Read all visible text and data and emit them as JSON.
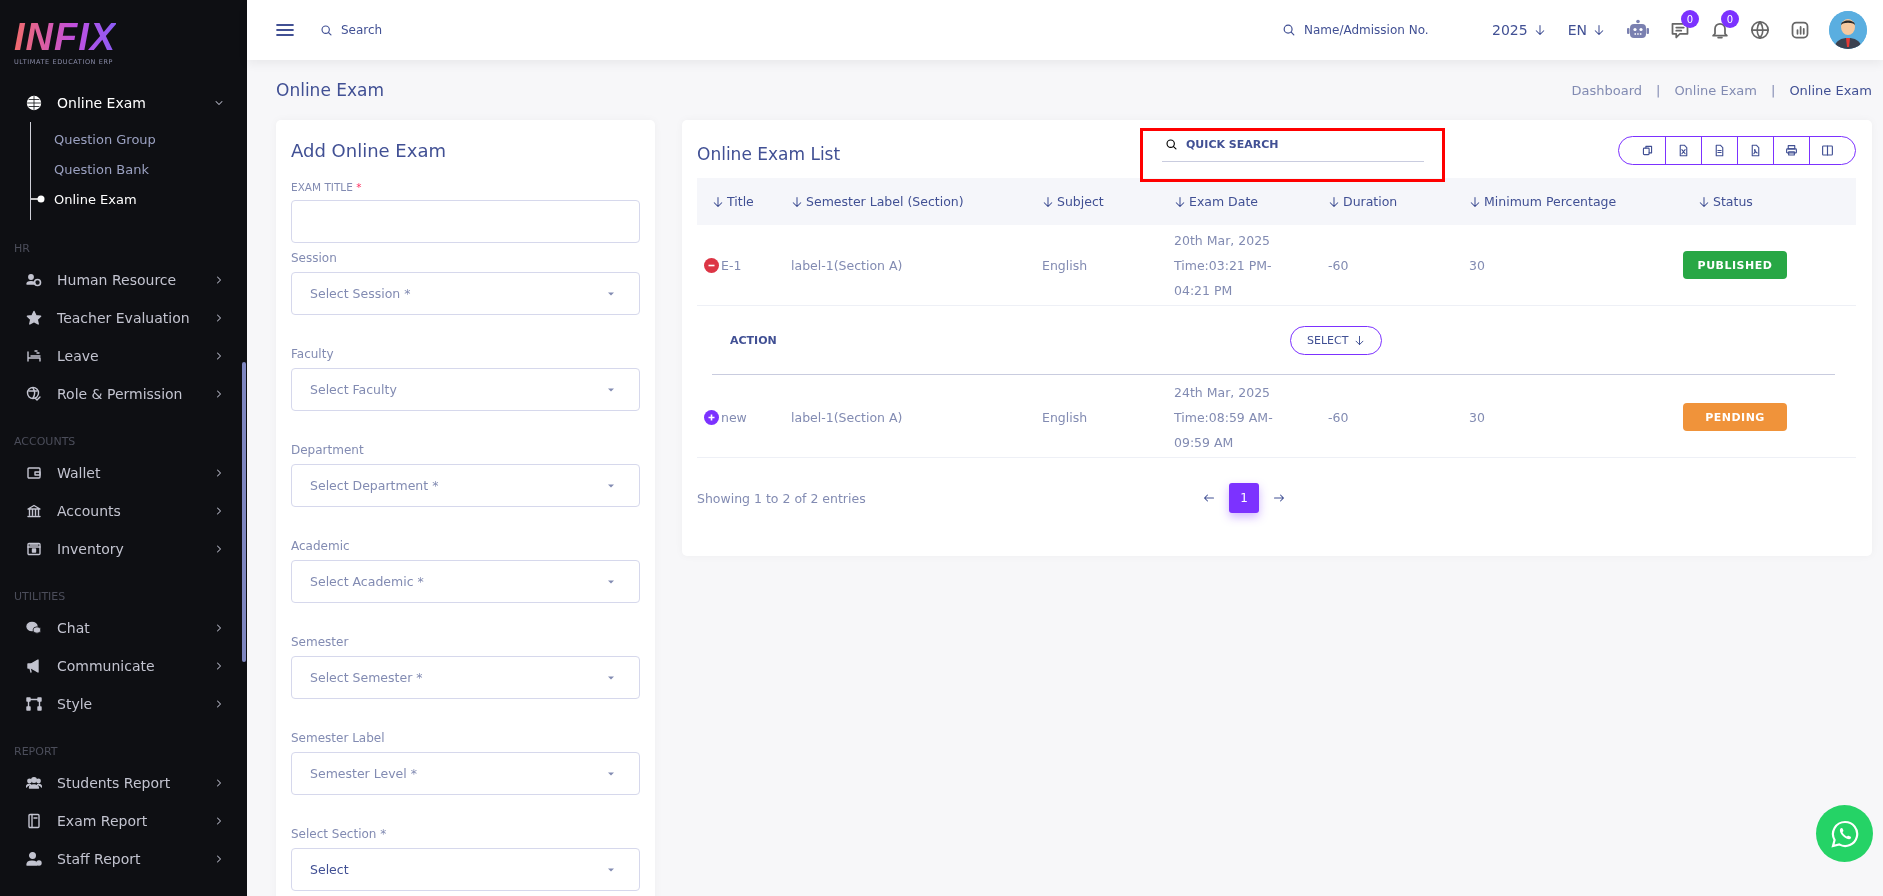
{
  "sidebar": {
    "logo": {
      "name": "INFIX",
      "tagline": "ULTIMATE EDUCATION ERP"
    },
    "sections": [
      {
        "items": [
          {
            "label": "Online Exam",
            "expanded": true,
            "children": [
              {
                "label": "Question Group",
                "selected": false
              },
              {
                "label": "Question Bank",
                "selected": false
              },
              {
                "label": "Online Exam",
                "selected": true
              }
            ]
          }
        ]
      },
      {
        "heading": "HR",
        "items": [
          {
            "label": "Human Resource",
            "expanded": false
          },
          {
            "label": "Teacher Evaluation",
            "expanded": false
          },
          {
            "label": "Leave",
            "expanded": false
          },
          {
            "label": "Role & Permission",
            "expanded": false
          }
        ]
      },
      {
        "heading": "ACCOUNTS",
        "items": [
          {
            "label": "Wallet",
            "expanded": false
          },
          {
            "label": "Accounts",
            "expanded": false
          },
          {
            "label": "Inventory",
            "expanded": false
          }
        ]
      },
      {
        "heading": "UTILITIES",
        "items": [
          {
            "label": "Chat",
            "expanded": false
          },
          {
            "label": "Communicate",
            "expanded": false
          },
          {
            "label": "Style",
            "expanded": false
          }
        ]
      },
      {
        "heading": "REPORT",
        "items": [
          {
            "label": "Students Report",
            "expanded": false
          },
          {
            "label": "Exam Report",
            "expanded": false
          },
          {
            "label": "Staff Report",
            "expanded": false
          }
        ]
      }
    ]
  },
  "topbar": {
    "search": {
      "placeholder": "Search"
    },
    "student_search": {
      "placeholder": "Name/Admission No."
    },
    "year": "2025",
    "language": "EN",
    "messages_badge": "0",
    "notifications_badge": "0"
  },
  "page": {
    "title": "Online Exam",
    "separator": "|",
    "breadcrumb": [
      {
        "label": "Dashboard",
        "selected": false
      },
      {
        "label": "Online Exam",
        "selected": false
      },
      {
        "label": "Online Exam",
        "selected": true
      }
    ]
  },
  "form": {
    "title": "Add Online Exam",
    "fields": [
      {
        "kind": "input",
        "label": "EXAM TITLE",
        "mark": "*"
      },
      {
        "kind": "select",
        "label": "Session",
        "placeholder": "Select Session *"
      },
      {
        "kind": "select",
        "label": "Faculty",
        "placeholder": "Select Faculty"
      },
      {
        "kind": "select",
        "label": "Department",
        "placeholder": "Select Department *"
      },
      {
        "kind": "select",
        "label": "Academic",
        "placeholder": "Select Academic *"
      },
      {
        "kind": "select",
        "label": "Semester",
        "placeholder": "Select Semester *"
      },
      {
        "kind": "select",
        "label": "Semester Label",
        "placeholder": "Semester Level *"
      },
      {
        "kind": "select",
        "label": "Select Section *",
        "value": "Select"
      }
    ]
  },
  "list": {
    "title": "Online Exam List",
    "quick_search": {
      "placeholder": "QUICK SEARCH"
    },
    "columns": [
      "Title",
      "Semester Label (Section)",
      "Subject",
      "Exam Date",
      "Duration",
      "Minimum Percentage",
      "Status"
    ],
    "rows": [
      {
        "expanded": true,
        "title": "E-1",
        "section": "label-1(Section A)",
        "subject": "English",
        "date": [
          "20th Mar, 2025",
          "Time:03:21 PM-",
          "04:21 PM"
        ],
        "duration": "-60",
        "minimum": "30",
        "status": {
          "kind": "published",
          "label": "PUBLISHED"
        },
        "action": {
          "label": "ACTION",
          "button": "SELECT"
        }
      },
      {
        "expanded": false,
        "title": "new",
        "section": "label-1(Section A)",
        "subject": "English",
        "date": [
          "24th Mar, 2025",
          "Time:08:59 AM-",
          "09:59 AM"
        ],
        "duration": "-60",
        "minimum": "30",
        "status": {
          "kind": "pending",
          "label": "PENDING"
        }
      }
    ],
    "footer": "Showing 1 to 2 of 2 entries",
    "pages": [
      {
        "label": "1",
        "selected": true
      }
    ]
  }
}
